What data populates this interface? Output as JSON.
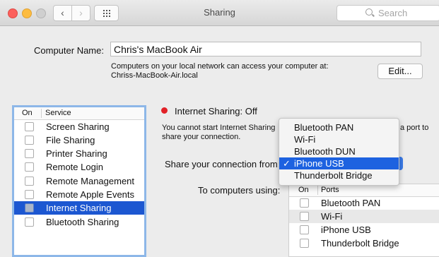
{
  "window": {
    "title": "Sharing",
    "search_placeholder": "Search"
  },
  "computer_name": {
    "label": "Computer Name:",
    "value": "Chris's MacBook Air",
    "note_line1": "Computers on your local network can access your computer at:",
    "note_line2": "Chriss-MacBook-Air.local",
    "edit_label": "Edit..."
  },
  "services": {
    "header_on": "On",
    "header_service": "Service",
    "items": [
      {
        "label": "Screen Sharing",
        "checked": false,
        "selected": false
      },
      {
        "label": "File Sharing",
        "checked": false,
        "selected": false
      },
      {
        "label": "Printer Sharing",
        "checked": false,
        "selected": false
      },
      {
        "label": "Remote Login",
        "checked": false,
        "selected": false
      },
      {
        "label": "Remote Management",
        "checked": false,
        "selected": false
      },
      {
        "label": "Remote Apple Events",
        "checked": false,
        "selected": false
      },
      {
        "label": "Internet Sharing",
        "checked": false,
        "selected": true
      },
      {
        "label": "Bluetooth Sharing",
        "checked": false,
        "selected": false
      }
    ]
  },
  "internet_sharing": {
    "status": "Internet Sharing: Off",
    "status_color": "#e12127",
    "desc_line1": "You cannot start Internet Sharing",
    "desc_line2": "share your connection.",
    "desc_tail": "a port to",
    "share_from_label": "Share your connection from:",
    "computers_using_label": "To computers using:",
    "dropdown": {
      "selected": "iPhone USB",
      "options": [
        "Bluetooth PAN",
        "Wi-Fi",
        "Bluetooth DUN",
        "iPhone USB",
        "Thunderbolt Bridge"
      ]
    },
    "ports": {
      "header_on": "On",
      "header_ports": "Ports",
      "items": [
        {
          "label": "Bluetooth PAN",
          "checked": false
        },
        {
          "label": "Wi-Fi",
          "checked": false
        },
        {
          "label": "iPhone USB",
          "checked": false
        },
        {
          "label": "Thunderbolt Bridge",
          "checked": false
        }
      ]
    }
  },
  "colors": {
    "selection": "#1c57d1",
    "menu_highlight": "#1d62e0",
    "focus_ring": "#8db7e8"
  }
}
